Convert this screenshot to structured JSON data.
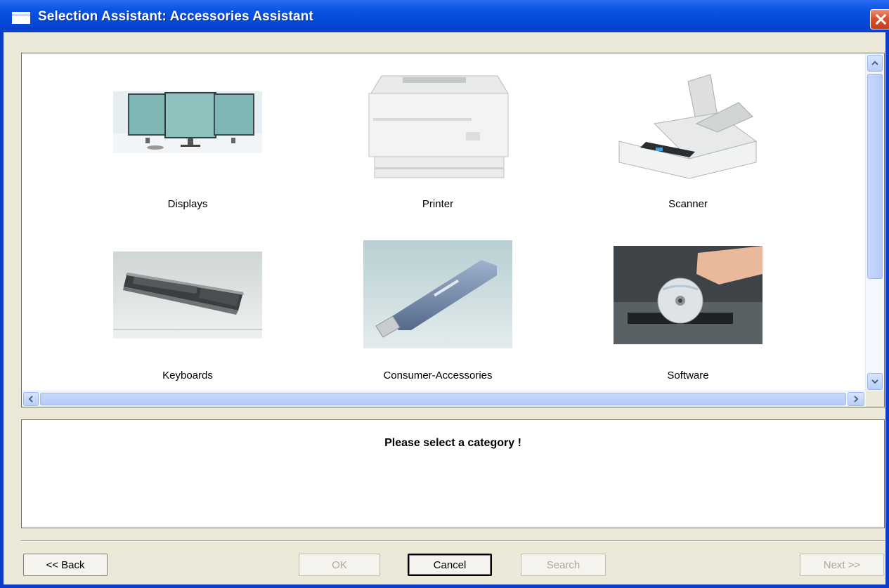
{
  "window": {
    "title": "Selection Assistant: Accessories Assistant",
    "close_icon": "close-icon"
  },
  "categories": [
    {
      "label": "Displays",
      "icon": "displays-image"
    },
    {
      "label": "Printer",
      "icon": "printer-image"
    },
    {
      "label": "Scanner",
      "icon": "scanner-image"
    },
    {
      "label": "Keyboards",
      "icon": "keyboard-image"
    },
    {
      "label": "Consumer-Accessories",
      "icon": "usb-stick-image"
    },
    {
      "label": "Software",
      "icon": "software-cd-image"
    }
  ],
  "status": {
    "message": "Please select a category !"
  },
  "buttons": {
    "back": "<< Back",
    "ok": "OK",
    "cancel": "Cancel",
    "search": "Search",
    "next": "Next >>"
  },
  "colors": {
    "titlebar": "#0a3ec9",
    "close": "#d9532e",
    "scrollbar": "#b9cff8",
    "dialog_bg": "#ece9d8"
  }
}
